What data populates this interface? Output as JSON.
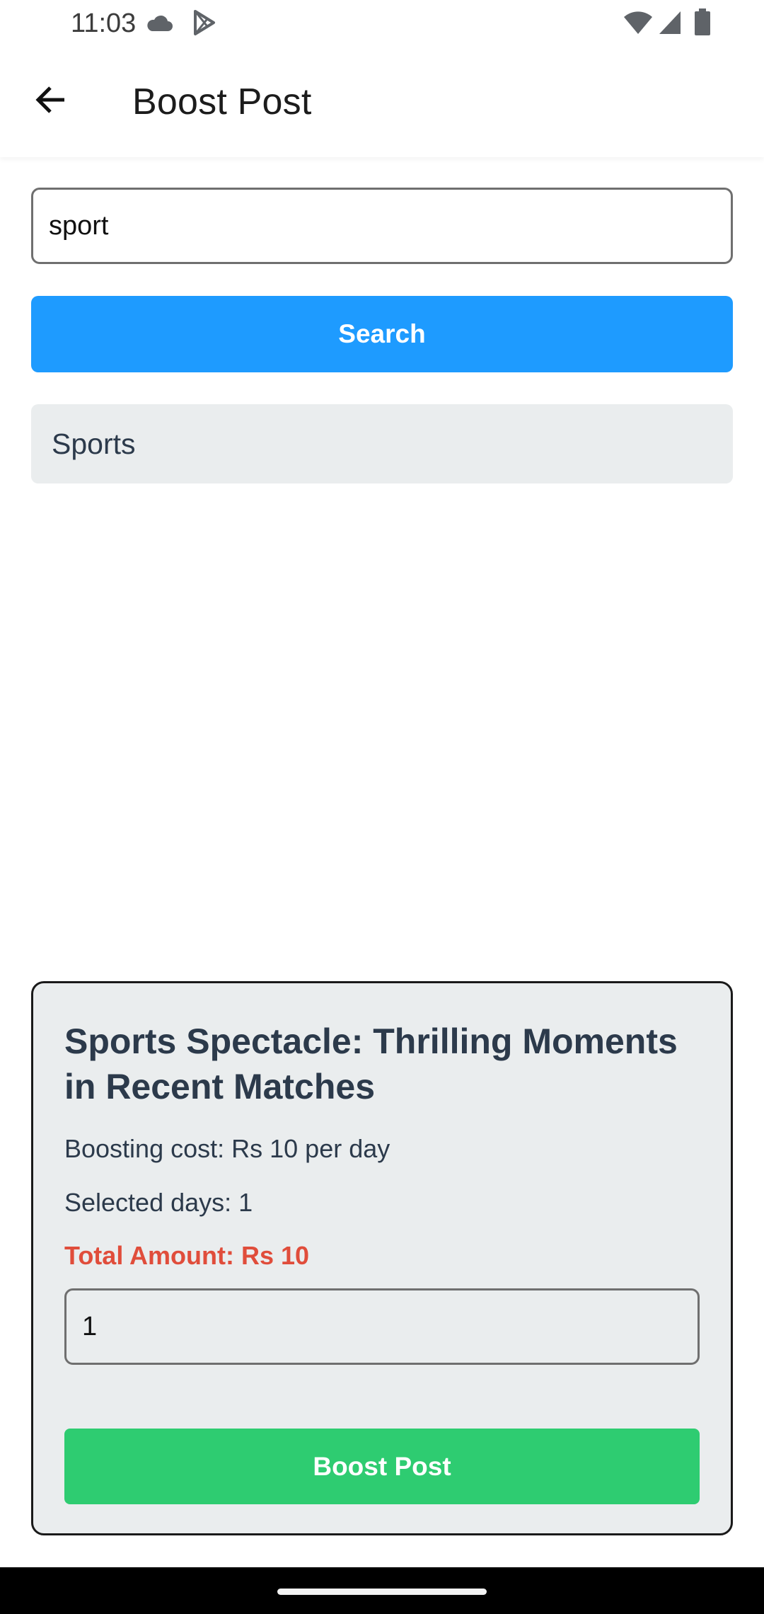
{
  "status_bar": {
    "time": "11:03",
    "icons": [
      "cloud-icon",
      "play-store-icon",
      "wifi-icon",
      "signal-icon",
      "battery-icon"
    ]
  },
  "app_bar": {
    "title": "Boost Post",
    "back_icon": "arrow-left-icon"
  },
  "search": {
    "value": "sport",
    "button_label": "Search"
  },
  "results": [
    {
      "label": "Sports"
    }
  ],
  "boost_card": {
    "post_title": "Sports Spectacle: Thrilling Moments in Recent Matches",
    "cost_text": "Boosting cost: Rs 10 per day",
    "days_text": "Selected days: 1",
    "total_text": "Total Amount: Rs 10",
    "days_value": "1",
    "button_label": "Boost Post"
  },
  "colors": {
    "primary_blue": "#1e9bff",
    "boost_green": "#2ecc71",
    "total_red": "#e04d3b",
    "card_bg": "#eaedee",
    "text_dark": "#2c3a4b"
  }
}
